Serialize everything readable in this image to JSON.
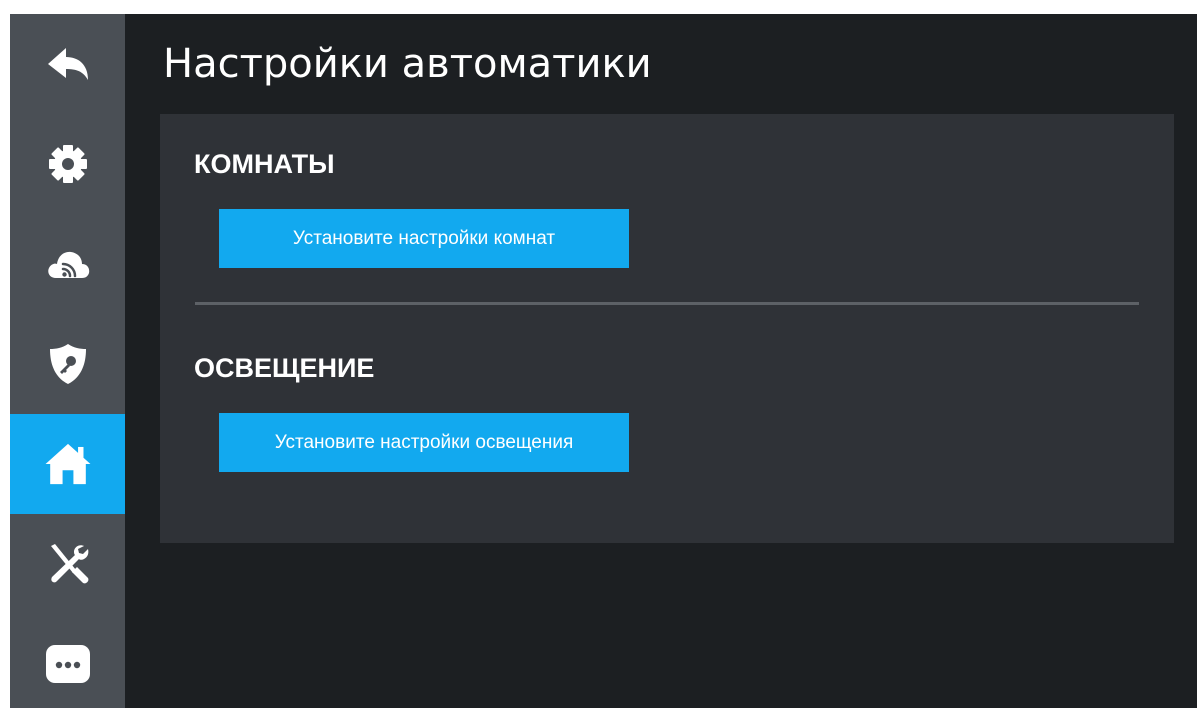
{
  "page": {
    "title": "Настройки автоматики"
  },
  "sidebar": {
    "items": [
      {
        "id": "back",
        "icon": "back-arrow-icon",
        "active": false
      },
      {
        "id": "settings",
        "icon": "gear-icon",
        "active": false
      },
      {
        "id": "network",
        "icon": "cloud-wifi-icon",
        "active": false
      },
      {
        "id": "security",
        "icon": "shield-key-icon",
        "active": false
      },
      {
        "id": "automation",
        "icon": "home-icon",
        "active": true
      },
      {
        "id": "tools",
        "icon": "tools-icon",
        "active": false
      },
      {
        "id": "more",
        "icon": "more-icon",
        "active": false
      }
    ]
  },
  "sections": {
    "rooms": {
      "title": "КОМНАТЫ",
      "button_label": "Установите настройки комнат"
    },
    "lighting": {
      "title": "ОСВЕЩЕНИЕ",
      "button_label": "Установите настройки освещения"
    }
  },
  "colors": {
    "accent": "#12a9ef",
    "sidebar_bg": "#4a4f55",
    "screen_bg": "#1c1f22",
    "panel_bg": "#2f3237",
    "divider": "#5d6166",
    "text": "#ffffff"
  }
}
